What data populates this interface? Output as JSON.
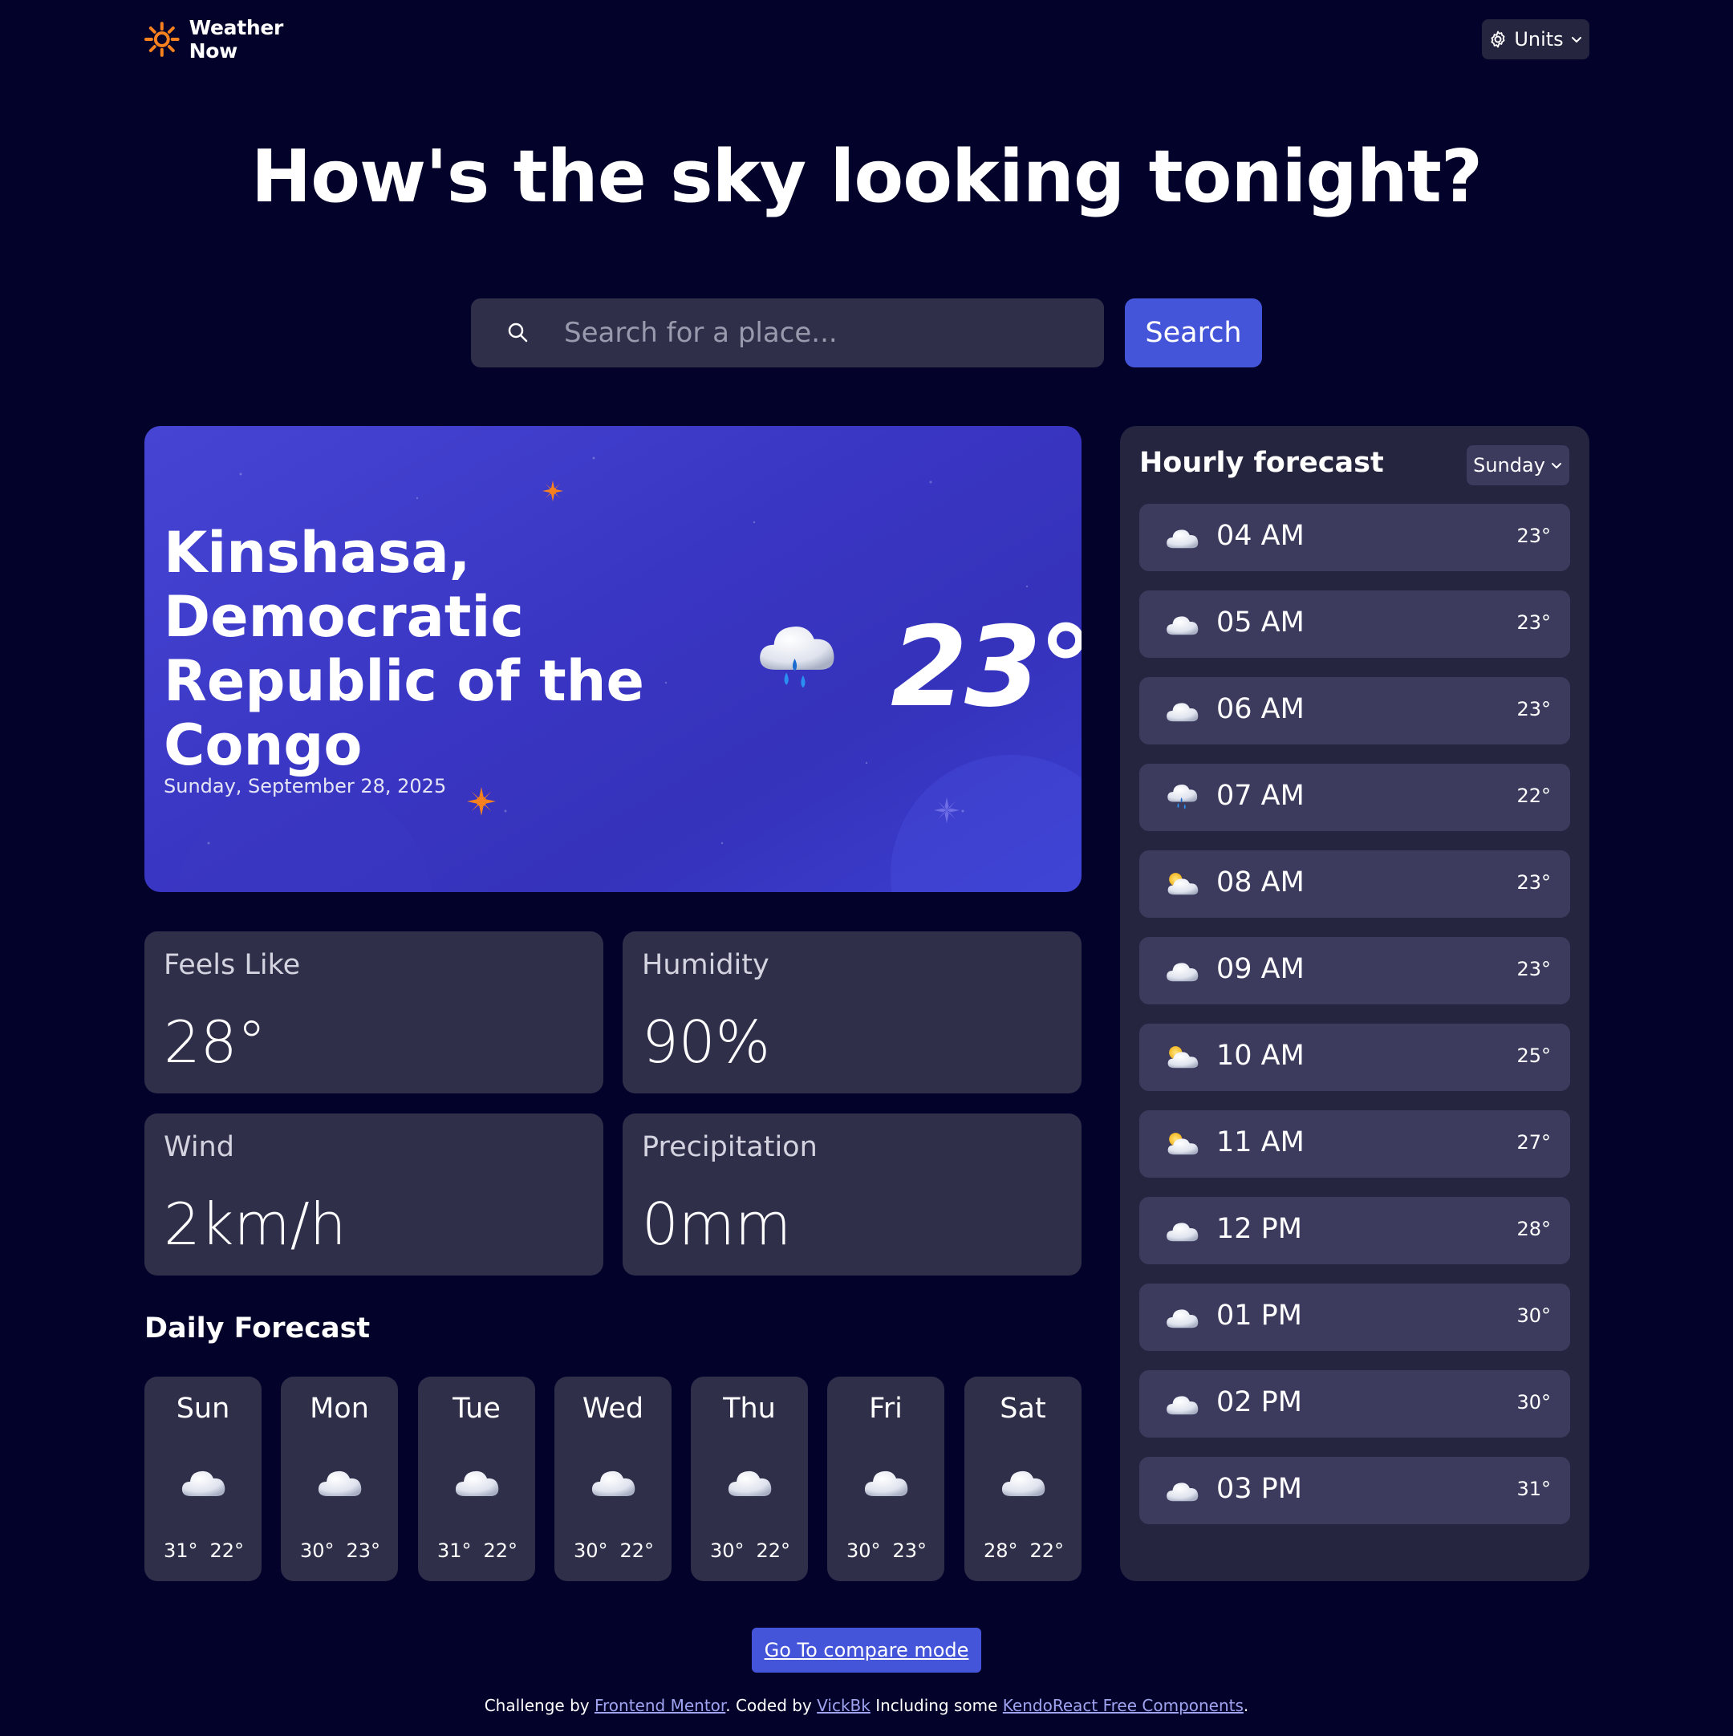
{
  "header": {
    "app_name": "Weather Now",
    "units_label": "Units"
  },
  "hero": {
    "headline": "How's the sky looking tonight?"
  },
  "search": {
    "placeholder": "Search for a place...",
    "button_label": "Search"
  },
  "current": {
    "location": "Kinshasa, Democratic Republic of the Congo",
    "date": "Sunday, September 28, 2025",
    "temperature": "23°",
    "icon": "rain-cloud-icon"
  },
  "stats": [
    {
      "label": "Feels Like",
      "value": "28°"
    },
    {
      "label": "Humidity",
      "value": "90%"
    },
    {
      "label": "Wind",
      "value": "2km/h"
    },
    {
      "label": "Precipitation",
      "value": "0mm"
    }
  ],
  "daily": {
    "title": "Daily Forecast",
    "days": [
      {
        "day": "Sun",
        "hi": "31°",
        "lo": "22°",
        "icon": "cloud-icon"
      },
      {
        "day": "Mon",
        "hi": "30°",
        "lo": "23°",
        "icon": "cloud-icon"
      },
      {
        "day": "Tue",
        "hi": "31°",
        "lo": "22°",
        "icon": "cloud-icon"
      },
      {
        "day": "Wed",
        "hi": "30°",
        "lo": "22°",
        "icon": "cloud-icon"
      },
      {
        "day": "Thu",
        "hi": "30°",
        "lo": "22°",
        "icon": "cloud-icon"
      },
      {
        "day": "Fri",
        "hi": "30°",
        "lo": "23°",
        "icon": "cloud-icon"
      },
      {
        "day": "Sat",
        "hi": "28°",
        "lo": "22°",
        "icon": "cloud-icon"
      }
    ]
  },
  "hourly": {
    "title": "Hourly forecast",
    "selected_day": "Sunday",
    "hours": [
      {
        "time": "04 AM",
        "temp": "23°",
        "icon": "cloud-icon"
      },
      {
        "time": "05 AM",
        "temp": "23°",
        "icon": "cloud-icon"
      },
      {
        "time": "06 AM",
        "temp": "23°",
        "icon": "cloud-icon"
      },
      {
        "time": "07 AM",
        "temp": "22°",
        "icon": "rain-cloud-icon"
      },
      {
        "time": "08 AM",
        "temp": "23°",
        "icon": "partly-cloudy-icon"
      },
      {
        "time": "09 AM",
        "temp": "23°",
        "icon": "cloud-icon"
      },
      {
        "time": "10 AM",
        "temp": "25°",
        "icon": "partly-cloudy-icon"
      },
      {
        "time": "11 AM",
        "temp": "27°",
        "icon": "partly-cloudy-icon"
      },
      {
        "time": "12 PM",
        "temp": "28°",
        "icon": "cloud-icon"
      },
      {
        "time": "01 PM",
        "temp": "30°",
        "icon": "cloud-icon"
      },
      {
        "time": "02 PM",
        "temp": "30°",
        "icon": "cloud-icon"
      },
      {
        "time": "03 PM",
        "temp": "31°",
        "icon": "cloud-icon"
      }
    ]
  },
  "compare_button": "Go To compare mode",
  "footer": {
    "challenge_prefix": "Challenge by ",
    "frontend_mentor": "Frontend Mentor",
    "coded_by_prefix": ". Coded by ",
    "author": "VickBk",
    "including_prefix": " Including some ",
    "kendo": "KendoReact Free Components",
    "suffix": "."
  },
  "colors": {
    "background": "#03022a",
    "card": "#302f4a",
    "panel": "#25253f",
    "row": "#3c3b5e",
    "accent": "#4455da",
    "sun_orange": "#f7811e"
  }
}
